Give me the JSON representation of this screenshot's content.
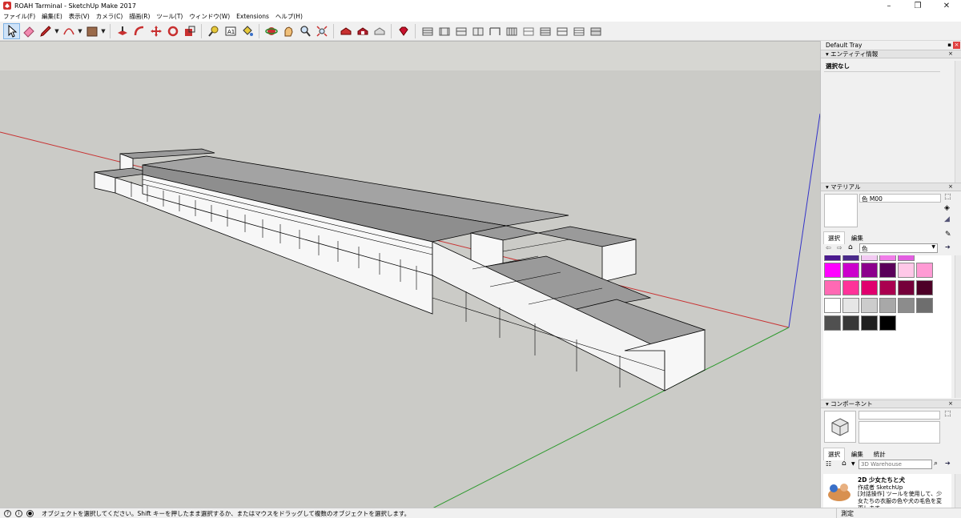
{
  "window": {
    "title": "ROAH Tarminal - SketchUp Make 2017",
    "controls": [
      "–",
      "❐",
      "✕"
    ]
  },
  "menu": [
    "ファイル(F)",
    "編集(E)",
    "表示(V)",
    "カメラ(C)",
    "描画(R)",
    "ツール(T)",
    "ウィンドウ(W)",
    "Extensions",
    "ヘルプ(H)"
  ],
  "toolbar_icons": [
    "select-icon",
    "eraser-icon",
    "pencil-icon",
    "arc-icon",
    "rectangle-icon",
    "push-pull-icon",
    "follow-me-icon",
    "move-icon",
    "rotate-icon",
    "scale-icon",
    "tape-measure-icon",
    "text-icon",
    "paint-bucket-icon",
    "orbit-icon",
    "pan-icon",
    "zoom-icon",
    "zoom-extents-icon",
    "warehouse-icon",
    "extension-warehouse-icon",
    "share-model-icon",
    "ruby-icon",
    "iso-view-icon",
    "top-view-icon",
    "front-view-icon",
    "right-view-icon",
    "back-view-icon",
    "left-view-icon",
    "xray-icon",
    "back-edges-icon",
    "wireframe-icon",
    "hidden-line-icon",
    "shaded-icon"
  ],
  "tray": {
    "title": "Default Tray",
    "entity_info": {
      "header": "エンティティ情報",
      "status": "選択なし"
    },
    "materials": {
      "header": "マテリアル",
      "name": "色 M00",
      "tab_select": "選択",
      "tab_edit": "編集",
      "collection": "色",
      "swatches": [
        [
          "#4b1a8f",
          "#4a2a8a",
          "#f2c9f2",
          "#f07de8",
          "#e25ee0"
        ],
        [
          "#ff00ff",
          "#cc00cc",
          "#8c008c",
          "#5a005a",
          "#ffc8e8",
          "#ff9ad4"
        ],
        [
          "#ff69b4",
          "#ff3399",
          "#e0006e",
          "#aa004f",
          "#75003a",
          "#4d0027"
        ],
        [
          "#ffffff",
          "#e6e6e6",
          "#cccccc",
          "#a8a8a8",
          "#8c8c8c",
          "#6e6e6e"
        ],
        [
          "#505050",
          "#383838",
          "#202020",
          "#000000"
        ]
      ]
    },
    "components": {
      "header": "コンポーネント",
      "tab_select": "選択",
      "tab_edit": "編集",
      "tab_stats": "統計",
      "search_placeholder": "3D Warehouse",
      "result": {
        "title": "2D 少女たちと犬",
        "author": "作成者 SketchUp",
        "desc": "[対話操作] ツールを使用して、少女たちの衣服の色や犬の毛色を変更します。"
      }
    }
  },
  "status": {
    "message": "オブジェクトを選択してください。Shift キーを押したまま選択するか、またはマウスをドラッグして複数のオブジェクトを選択します。",
    "measurement_label": "測定"
  },
  "colors": {
    "viewport_bg": "#cbcbc7",
    "sky": "#d6d6d2",
    "axis_red": "#c83232",
    "axis_green": "#2f9a2f",
    "axis_blue": "#3333c8",
    "roof": "#9a9a9a",
    "wall": "#f7f7f7"
  }
}
